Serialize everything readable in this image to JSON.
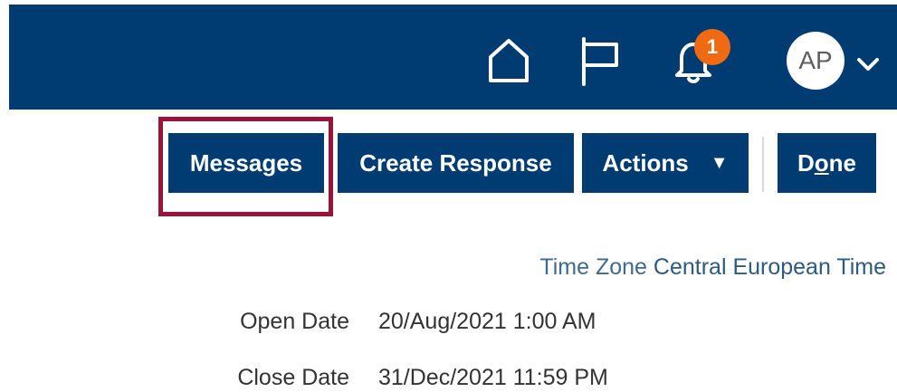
{
  "header": {
    "home_icon": "home-icon",
    "flag_icon": "flag-icon",
    "notifications": {
      "icon": "bell-icon",
      "badge_count": "1"
    },
    "user": {
      "initials": "AP",
      "menu_icon": "chevron-down-icon"
    },
    "colors": {
      "bar": "#003b71",
      "badge": "#f06a13"
    }
  },
  "toolbar": {
    "messages_label": "Messages",
    "create_response_label": "Create Response",
    "actions_label": "Actions",
    "actions_arrow": "▼",
    "done_label": {
      "before": "D",
      "underlined": "o",
      "after": "ne"
    },
    "highlight_color": "#9a1438"
  },
  "details": {
    "time_zone": {
      "label": "Time Zone",
      "value": "Central European Time"
    },
    "open_date": {
      "label": "Open Date",
      "value": "20/Aug/2021 1:00 AM"
    },
    "close_date": {
      "label": "Close Date",
      "value": "31/Dec/2021 11:59 PM"
    }
  }
}
